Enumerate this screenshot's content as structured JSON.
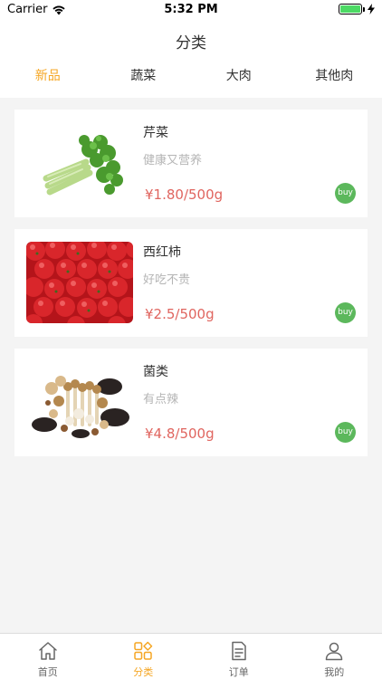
{
  "status_bar": {
    "carrier": "Carrier",
    "time": "5:32 PM",
    "battery_level": 1.0
  },
  "nav": {
    "title": "分类"
  },
  "category_tabs": [
    {
      "label": "新品",
      "active": true
    },
    {
      "label": "蔬菜",
      "active": false
    },
    {
      "label": "大肉",
      "active": false
    },
    {
      "label": "其他肉",
      "active": false
    }
  ],
  "products": [
    {
      "name": "芹菜",
      "desc": "健康又营养",
      "price": "¥1.80/500g",
      "buy_label": "buy",
      "image": "celery-image"
    },
    {
      "name": "西红柿",
      "desc": "好吃不贵",
      "price": "¥2.5/500g",
      "buy_label": "buy",
      "image": "tomato-image"
    },
    {
      "name": "菌类",
      "desc": "有点辣",
      "price": "¥4.8/500g",
      "buy_label": "buy",
      "image": "mushroom-image"
    }
  ],
  "tabbar": [
    {
      "label": "首页",
      "icon": "home-icon",
      "active": false
    },
    {
      "label": "分类",
      "icon": "category-icon",
      "active": true
    },
    {
      "label": "订单",
      "icon": "order-icon",
      "active": false
    },
    {
      "label": "我的",
      "icon": "profile-icon",
      "active": false
    }
  ],
  "colors": {
    "accent": "#f5a623",
    "price": "#e0655f",
    "buy": "#5cb85c",
    "background": "#f4f4f4"
  }
}
